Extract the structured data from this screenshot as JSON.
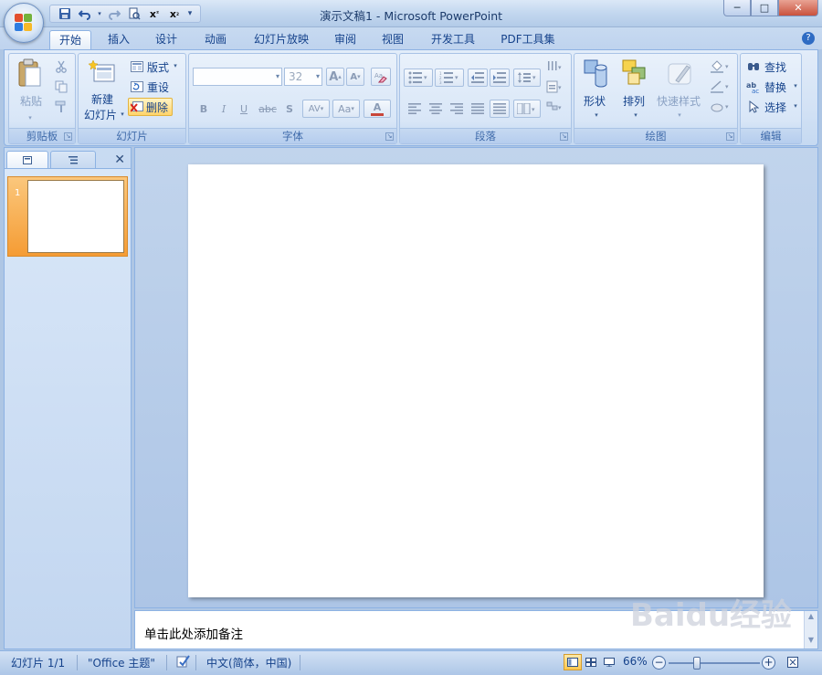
{
  "window": {
    "title": "演示文稿1 - Microsoft PowerPoint",
    "controls": {
      "minimize": "─",
      "maximize": "□",
      "close": "✕"
    }
  },
  "qat": {
    "customize": "▾"
  },
  "tabs": [
    "开始",
    "插入",
    "设计",
    "动画",
    "幻灯片放映",
    "审阅",
    "视图",
    "开发工具",
    "PDF工具集"
  ],
  "ribbon": {
    "clipboard": {
      "label": "剪贴板",
      "paste": "粘贴"
    },
    "slides": {
      "label": "幻灯片",
      "new_line1": "新建",
      "new_line2": "幻灯片",
      "layout": "版式",
      "reset": "重设",
      "delete": "删除"
    },
    "font": {
      "label": "字体",
      "font_name": "",
      "font_size": "32",
      "bold": "B",
      "italic": "I",
      "underline": "U",
      "strike": "abc",
      "shadow": "S",
      "spacing": "AV",
      "case": "Aa",
      "color": "A",
      "grow": "A",
      "shrink": "A"
    },
    "paragraph": {
      "label": "段落"
    },
    "drawing": {
      "label": "绘图",
      "shapes": "形状",
      "arrange": "排列",
      "quick_styles": "快速样式"
    },
    "editing": {
      "label": "编辑",
      "find": "查找",
      "replace": "替换",
      "select": "选择"
    }
  },
  "pane": {
    "close": "✕",
    "thumbnails": [
      {
        "number": "1"
      }
    ]
  },
  "notes": {
    "placeholder": "单击此处添加备注"
  },
  "watermark": "Baidu经验",
  "status": {
    "slide": "幻灯片 1/1",
    "theme": "\"Office 主题\"",
    "language": "中文(简体，中国)",
    "zoom": "66%",
    "zoom_level_percent": 66
  },
  "colors": {
    "accent": "#15428b",
    "selected_thumb": "#f59c34"
  }
}
